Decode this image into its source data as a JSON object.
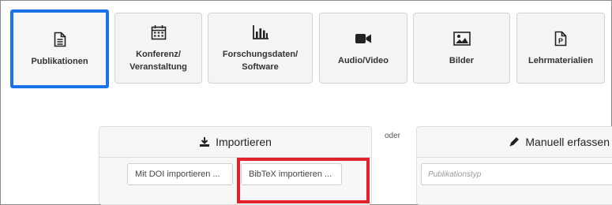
{
  "resource_types": [
    {
      "label": "Publikationen",
      "icon": "document-icon",
      "selected": true
    },
    {
      "label": "Konferenz/\nVeranstaltung",
      "icon": "calendar-icon",
      "selected": false
    },
    {
      "label": "Forschungsdaten/\nSoftware",
      "icon": "bar-chart-icon",
      "selected": false
    },
    {
      "label": "Audio/Video",
      "icon": "video-camera-icon",
      "selected": false
    },
    {
      "label": "Bilder",
      "icon": "image-icon",
      "selected": false
    },
    {
      "label": "Lehrmaterialien",
      "icon": "presentation-icon",
      "selected": false
    }
  ],
  "separator_text": "oder",
  "import_panel": {
    "title": "Importieren",
    "icon": "download-icon",
    "doi_button": "Mit DOI importieren ...",
    "bibtex_button": "BibTeX importieren ..."
  },
  "manual_panel": {
    "title": "Manuell erfassen",
    "icon": "pencil-icon",
    "type_placeholder": "Publikationstyp"
  },
  "colors": {
    "selected_border": "#1a73e8",
    "highlight_border": "#e3212b"
  }
}
